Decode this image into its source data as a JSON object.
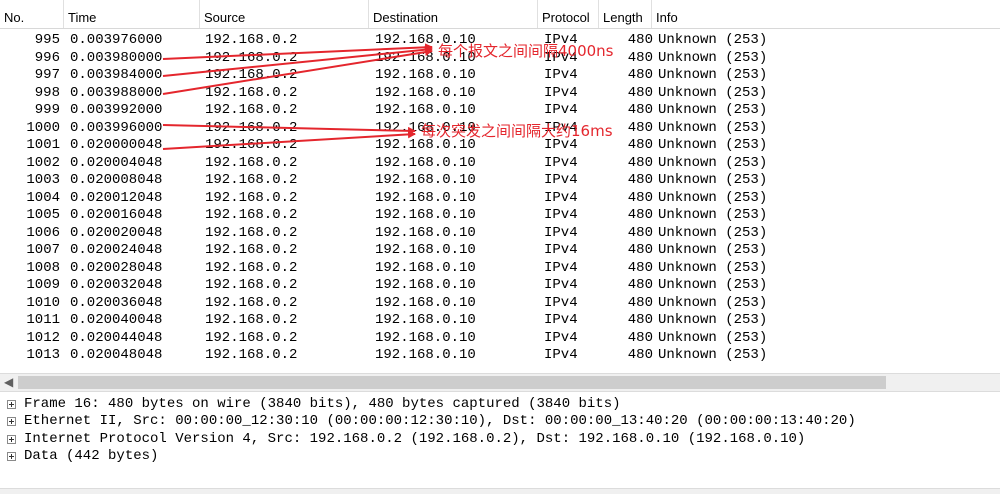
{
  "columns": {
    "no": "No.",
    "time": "Time",
    "source": "Source",
    "destination": "Destination",
    "protocol": "Protocol",
    "length": "Length",
    "info": "Info"
  },
  "packets": [
    {
      "no": "995",
      "time": "0.003976000",
      "source": "192.168.0.2",
      "destination": "192.168.0.10",
      "protocol": "IPv4",
      "length": "480",
      "info": "Unknown (253)"
    },
    {
      "no": "996",
      "time": "0.003980000",
      "source": "192.168.0.2",
      "destination": "192.168.0.10",
      "protocol": "IPv4",
      "length": "480",
      "info": "Unknown (253)"
    },
    {
      "no": "997",
      "time": "0.003984000",
      "source": "192.168.0.2",
      "destination": "192.168.0.10",
      "protocol": "IPv4",
      "length": "480",
      "info": "Unknown (253)"
    },
    {
      "no": "998",
      "time": "0.003988000",
      "source": "192.168.0.2",
      "destination": "192.168.0.10",
      "protocol": "IPv4",
      "length": "480",
      "info": "Unknown (253)"
    },
    {
      "no": "999",
      "time": "0.003992000",
      "source": "192.168.0.2",
      "destination": "192.168.0.10",
      "protocol": "IPv4",
      "length": "480",
      "info": "Unknown (253)"
    },
    {
      "no": "1000",
      "time": "0.003996000",
      "source": "192.168.0.2",
      "destination": "192.168.0.10",
      "protocol": "IPv4",
      "length": "480",
      "info": "Unknown (253)"
    },
    {
      "no": "1001",
      "time": "0.020000048",
      "source": "192.168.0.2",
      "destination": "192.168.0.10",
      "protocol": "IPv4",
      "length": "480",
      "info": "Unknown (253)"
    },
    {
      "no": "1002",
      "time": "0.020004048",
      "source": "192.168.0.2",
      "destination": "192.168.0.10",
      "protocol": "IPv4",
      "length": "480",
      "info": "Unknown (253)"
    },
    {
      "no": "1003",
      "time": "0.020008048",
      "source": "192.168.0.2",
      "destination": "192.168.0.10",
      "protocol": "IPv4",
      "length": "480",
      "info": "Unknown (253)"
    },
    {
      "no": "1004",
      "time": "0.020012048",
      "source": "192.168.0.2",
      "destination": "192.168.0.10",
      "protocol": "IPv4",
      "length": "480",
      "info": "Unknown (253)"
    },
    {
      "no": "1005",
      "time": "0.020016048",
      "source": "192.168.0.2",
      "destination": "192.168.0.10",
      "protocol": "IPv4",
      "length": "480",
      "info": "Unknown (253)"
    },
    {
      "no": "1006",
      "time": "0.020020048",
      "source": "192.168.0.2",
      "destination": "192.168.0.10",
      "protocol": "IPv4",
      "length": "480",
      "info": "Unknown (253)"
    },
    {
      "no": "1007",
      "time": "0.020024048",
      "source": "192.168.0.2",
      "destination": "192.168.0.10",
      "protocol": "IPv4",
      "length": "480",
      "info": "Unknown (253)"
    },
    {
      "no": "1008",
      "time": "0.020028048",
      "source": "192.168.0.2",
      "destination": "192.168.0.10",
      "protocol": "IPv4",
      "length": "480",
      "info": "Unknown (253)"
    },
    {
      "no": "1009",
      "time": "0.020032048",
      "source": "192.168.0.2",
      "destination": "192.168.0.10",
      "protocol": "IPv4",
      "length": "480",
      "info": "Unknown (253)"
    },
    {
      "no": "1010",
      "time": "0.020036048",
      "source": "192.168.0.2",
      "destination": "192.168.0.10",
      "protocol": "IPv4",
      "length": "480",
      "info": "Unknown (253)"
    },
    {
      "no": "1011",
      "time": "0.020040048",
      "source": "192.168.0.2",
      "destination": "192.168.0.10",
      "protocol": "IPv4",
      "length": "480",
      "info": "Unknown (253)"
    },
    {
      "no": "1012",
      "time": "0.020044048",
      "source": "192.168.0.2",
      "destination": "192.168.0.10",
      "protocol": "IPv4",
      "length": "480",
      "info": "Unknown (253)"
    },
    {
      "no": "1013",
      "time": "0.020048048",
      "source": "192.168.0.2",
      "destination": "192.168.0.10",
      "protocol": "IPv4",
      "length": "480",
      "info": "Unknown (253)"
    }
  ],
  "annotations": {
    "packet_gap": "每个报文之间间隔4000ns",
    "burst_gap": "每次突发之间间隔大约16ms",
    "color": "#e4262d"
  },
  "scrollbar": {
    "left_arrow_icon": "left-arrow-icon"
  },
  "details": [
    {
      "text": "Frame 16: 480 bytes on wire (3840 bits), 480 bytes captured (3840 bits)"
    },
    {
      "text": "Ethernet II, Src: 00:00:00_12:30:10 (00:00:00:12:30:10), Dst: 00:00:00_13:40:20 (00:00:00:13:40:20)"
    },
    {
      "text": "Internet Protocol Version 4, Src: 192.168.0.2 (192.168.0.2), Dst: 192.168.0.10 (192.168.0.10)"
    },
    {
      "text": "Data (442 bytes)"
    }
  ]
}
